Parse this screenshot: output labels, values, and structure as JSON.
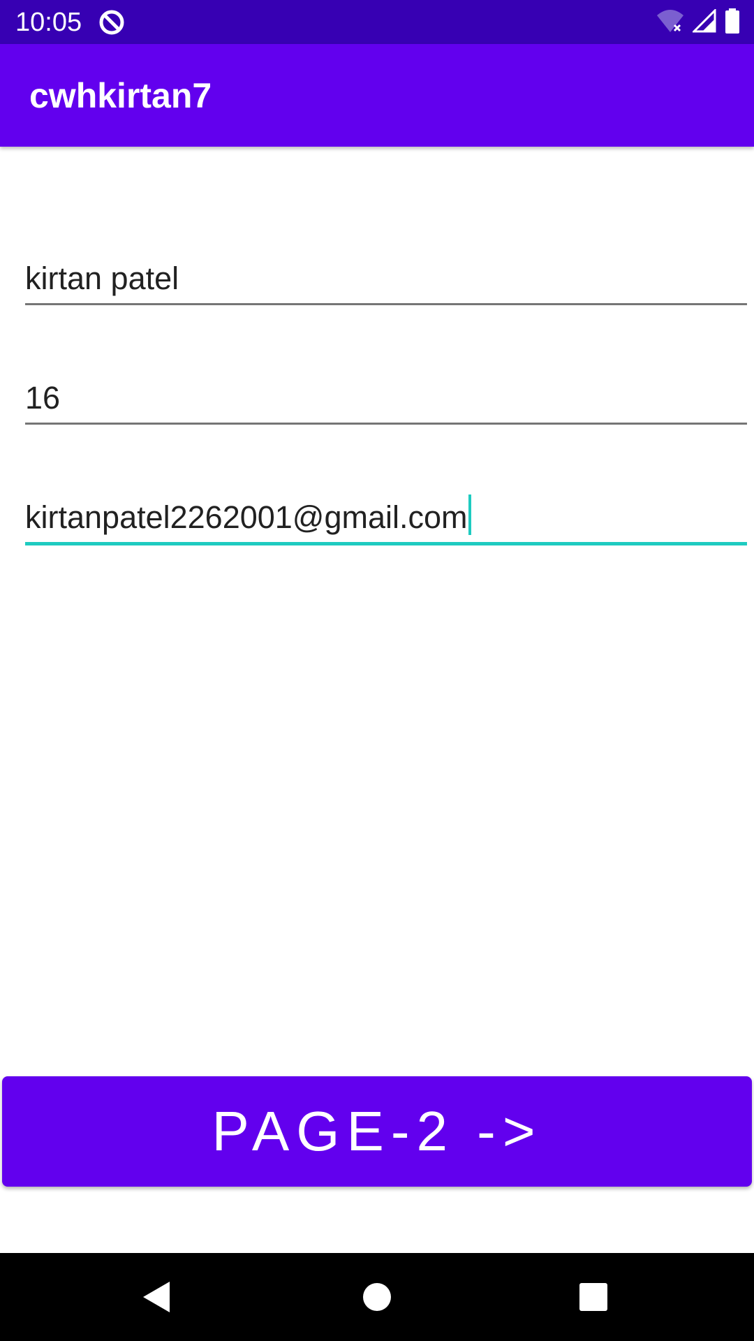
{
  "status_bar": {
    "time": "10:05",
    "icons": [
      "app-notification-icon",
      "wifi-icon",
      "signal-icon",
      "battery-icon"
    ]
  },
  "app_bar": {
    "title": "cwhkirtan7"
  },
  "form": {
    "name_value": "kirtan patel",
    "age_value": "16",
    "email_value": "kirtanpatel2262001@gmail.com"
  },
  "button": {
    "label": "PAGE-2 ->"
  },
  "nav_bar": {
    "icons": [
      "back-icon",
      "home-icon",
      "recents-icon"
    ]
  },
  "colors": {
    "status_bar": "#3700b3",
    "primary": "#6200ee",
    "focus_accent": "#1ecbc0",
    "underline": "#757575",
    "text": "#212121"
  }
}
